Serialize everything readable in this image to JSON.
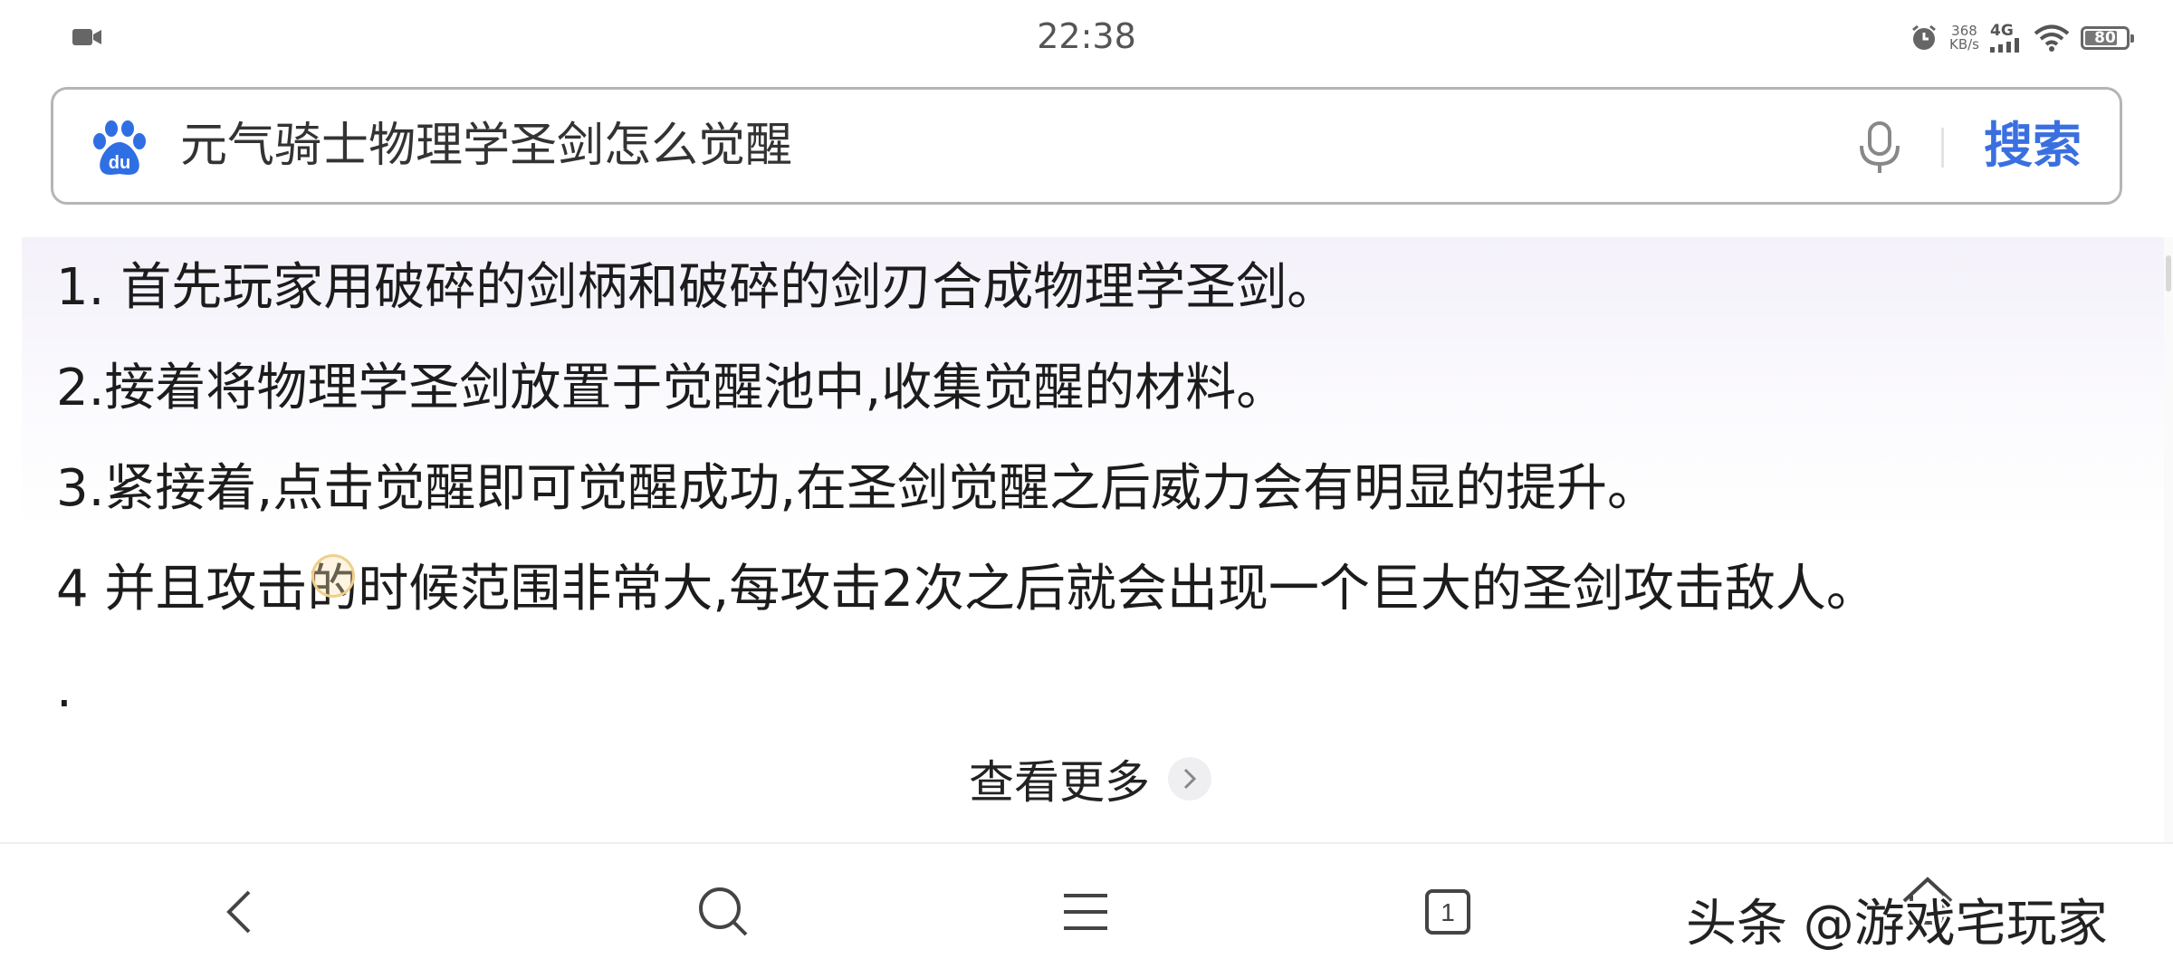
{
  "status_bar": {
    "time": "22:38",
    "net_speed_value": "368",
    "net_speed_unit": "KB/s",
    "network": "4G",
    "battery": "80"
  },
  "search": {
    "query": "元气骑士物理学圣剑怎么觉醒",
    "button_label": "搜索",
    "brand_logo_text": "du"
  },
  "answer": {
    "steps": [
      "1. 首先玩家用破碎的剑柄和破碎的剑刃合成物理学圣剑。",
      "2.接着将物理学圣剑放置于觉醒池中,收集觉醒的材料。",
      "3.紧接着,点击觉醒即可觉醒成功,在圣剑觉醒之后威力会有明显的提升。",
      "4 并且攻击的时候范围非常大,每攻击2次之后就会出现一个巨大的圣剑攻击敌人。",
      "."
    ],
    "see_more_label": "查看更多"
  },
  "bottom_nav": {
    "tab_count": "1",
    "items": [
      "back-icon",
      "search-icon",
      "menu-icon",
      "tabs-icon",
      "home-icon"
    ]
  },
  "watermark": "头条 @游戏宅玩家",
  "colors": {
    "accent": "#3a6fe0",
    "baidu_blue": "#2f6fe4",
    "text": "#1c1c1c"
  }
}
